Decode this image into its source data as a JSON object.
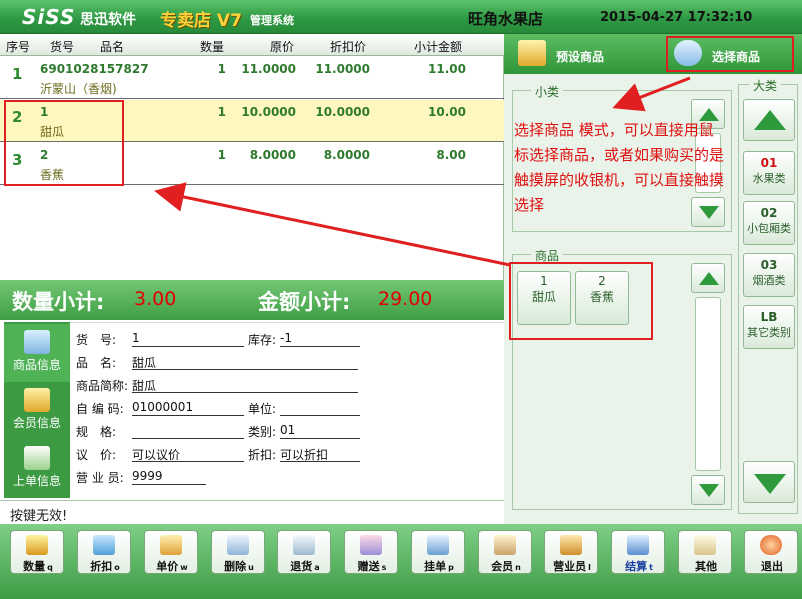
{
  "header": {
    "brand": "SiSS",
    "brand_cn": "思迅软件",
    "product": "专卖店 V7",
    "product_suffix": "管理系统",
    "store": "旺角水果店",
    "datetime": "2015-04-27 17:32:10"
  },
  "table": {
    "columns": [
      "序号",
      "货号",
      "品名",
      "数量",
      "原价",
      "折扣价",
      "小计金额"
    ],
    "rows": [
      {
        "idx": "1",
        "code": "6901028157827",
        "name": "沂蒙山（香烟)",
        "qty": "1",
        "price": "11.0000",
        "disc": "11.0000",
        "subtotal": "11.00"
      },
      {
        "idx": "2",
        "code": "1",
        "name": "甜瓜",
        "qty": "1",
        "price": "10.0000",
        "disc": "10.0000",
        "subtotal": "10.00"
      },
      {
        "idx": "3",
        "code": "2",
        "name": "香蕉",
        "qty": "1",
        "price": "8.0000",
        "disc": "8.0000",
        "subtotal": "8.00"
      }
    ]
  },
  "totals": {
    "qty_label": "数量小计:",
    "qty_value": "3.00",
    "amount_label": "金额小计:",
    "amount_value": "29.00"
  },
  "info_tabs": [
    "商品信息",
    "会员信息",
    "上单信息"
  ],
  "info": {
    "code_label": "货　号:",
    "code_value": "1",
    "stock_label": "库存:",
    "stock_value": "-1",
    "name_label": "品　名:",
    "name_value": "甜瓜",
    "short_label": "商品简称:",
    "short_value": "甜瓜",
    "selfcode_label": "自 编 码:",
    "selfcode_value": "01000001",
    "unit_label": "单位:",
    "unit_value": "",
    "spec_label": "规　格:",
    "spec_value": "",
    "category_label": "类别:",
    "category_value": "01",
    "bargain_label": "议　价:",
    "bargain_value": "可以议价",
    "discount_label": "折扣:",
    "discount_value": "可以折扣",
    "clerk_label": "营 业 员:",
    "clerk_value": "9999"
  },
  "status": "按键无效!",
  "right": {
    "preset_label": "预设商品",
    "select_label": "选择商品",
    "subcat_legend": "小类",
    "goods_legend": "商品",
    "maincat_legend": "大类",
    "note": "选择商品 模式，可以直接用鼠标选择商品，或者如果购买的是触摸屏的收银机，可以直接触摸选择",
    "goods": [
      {
        "code": "1",
        "name": "甜瓜"
      },
      {
        "code": "2",
        "name": "香蕉"
      }
    ],
    "categories": [
      {
        "code": "01",
        "name": "水果类"
      },
      {
        "code": "02",
        "name": "小包厢类"
      },
      {
        "code": "03",
        "name": "烟酒类"
      },
      {
        "code": "LB",
        "name": "其它类别"
      }
    ]
  },
  "toolbar": [
    {
      "label": "数量",
      "key": "q"
    },
    {
      "label": "折扣",
      "key": "o"
    },
    {
      "label": "单价",
      "key": "w"
    },
    {
      "label": "删除",
      "key": "u"
    },
    {
      "label": "退货",
      "key": "a"
    },
    {
      "label": "赠送",
      "key": "s"
    },
    {
      "label": "挂单",
      "key": "p"
    },
    {
      "label": "会员",
      "key": "n"
    },
    {
      "label": "营业员",
      "key": "l"
    },
    {
      "label": "结算",
      "key": "t"
    },
    {
      "label": "其他",
      "key": ""
    },
    {
      "label": "退出",
      "key": ""
    }
  ],
  "colors": {
    "accent": "#3f9f46",
    "alert": "#e02020",
    "settle_label": "#1a3fa0"
  }
}
